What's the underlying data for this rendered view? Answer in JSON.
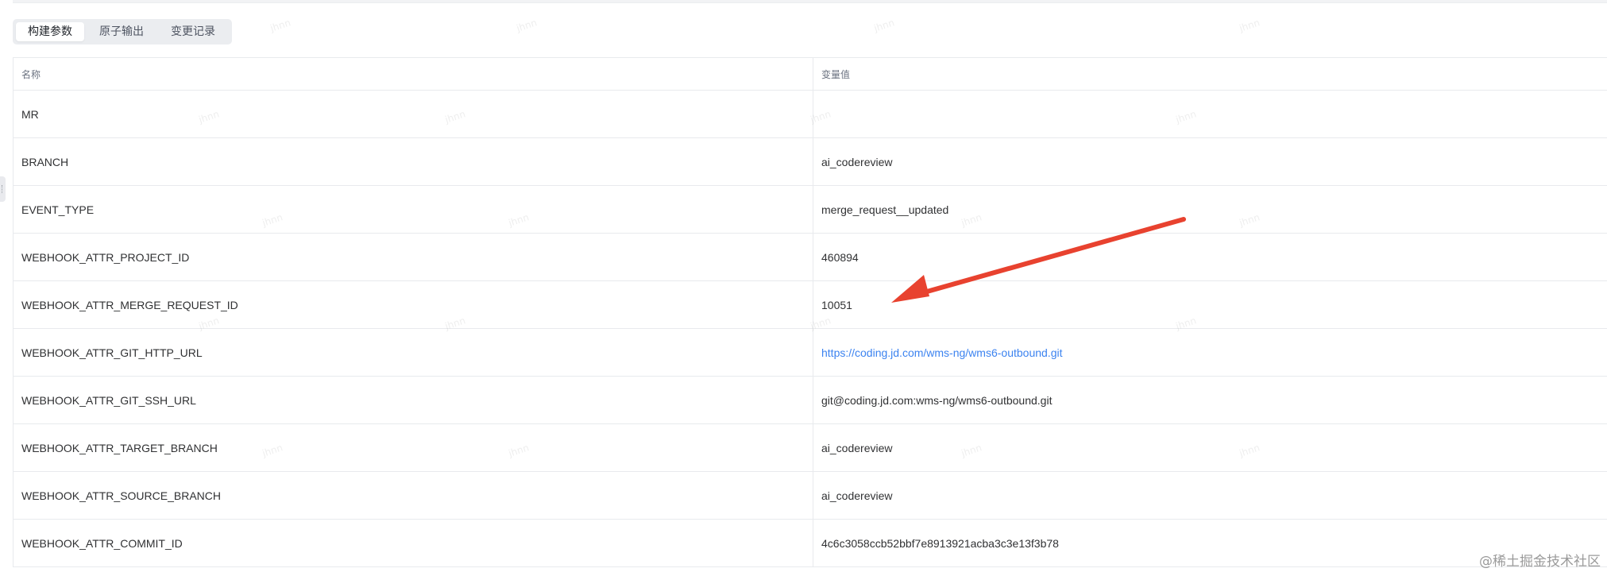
{
  "tabs": [
    {
      "label": "构建参数",
      "active": true
    },
    {
      "label": "原子输出",
      "active": false
    },
    {
      "label": "变更记录",
      "active": false
    }
  ],
  "table": {
    "headers": {
      "name": "名称",
      "value": "变量值"
    },
    "rows": [
      {
        "name": "MR",
        "value": ""
      },
      {
        "name": "BRANCH",
        "value": "ai_codereview"
      },
      {
        "name": "EVENT_TYPE",
        "value": "merge_request__updated"
      },
      {
        "name": "WEBHOOK_ATTR_PROJECT_ID",
        "value": "460894"
      },
      {
        "name": "WEBHOOK_ATTR_MERGE_REQUEST_ID",
        "value": "10051"
      },
      {
        "name": "WEBHOOK_ATTR_GIT_HTTP_URL",
        "value": "https://coding.jd.com/wms-ng/wms6-outbound.git",
        "is_link": true
      },
      {
        "name": "WEBHOOK_ATTR_GIT_SSH_URL",
        "value": "git@coding.jd.com:wms-ng/wms6-outbound.git"
      },
      {
        "name": "WEBHOOK_ATTR_TARGET_BRANCH",
        "value": "ai_codereview"
      },
      {
        "name": "WEBHOOK_ATTR_SOURCE_BRANCH",
        "value": "ai_codereview"
      },
      {
        "name": "WEBHOOK_ATTR_COMMIT_ID",
        "value": "4c6c3058ccb52bbf7e8913921acba3c3e13f3b78"
      }
    ]
  },
  "corner_watermark": "@稀土掘金技术社区",
  "colors": {
    "link": "#3c83f0",
    "arrow": "#e8422f",
    "border": "#e8eaed",
    "tab_bg": "#ebedf0"
  },
  "icons": {
    "side_handle": "drag-handle-icon",
    "annotation": "red-arrow-annotation"
  }
}
